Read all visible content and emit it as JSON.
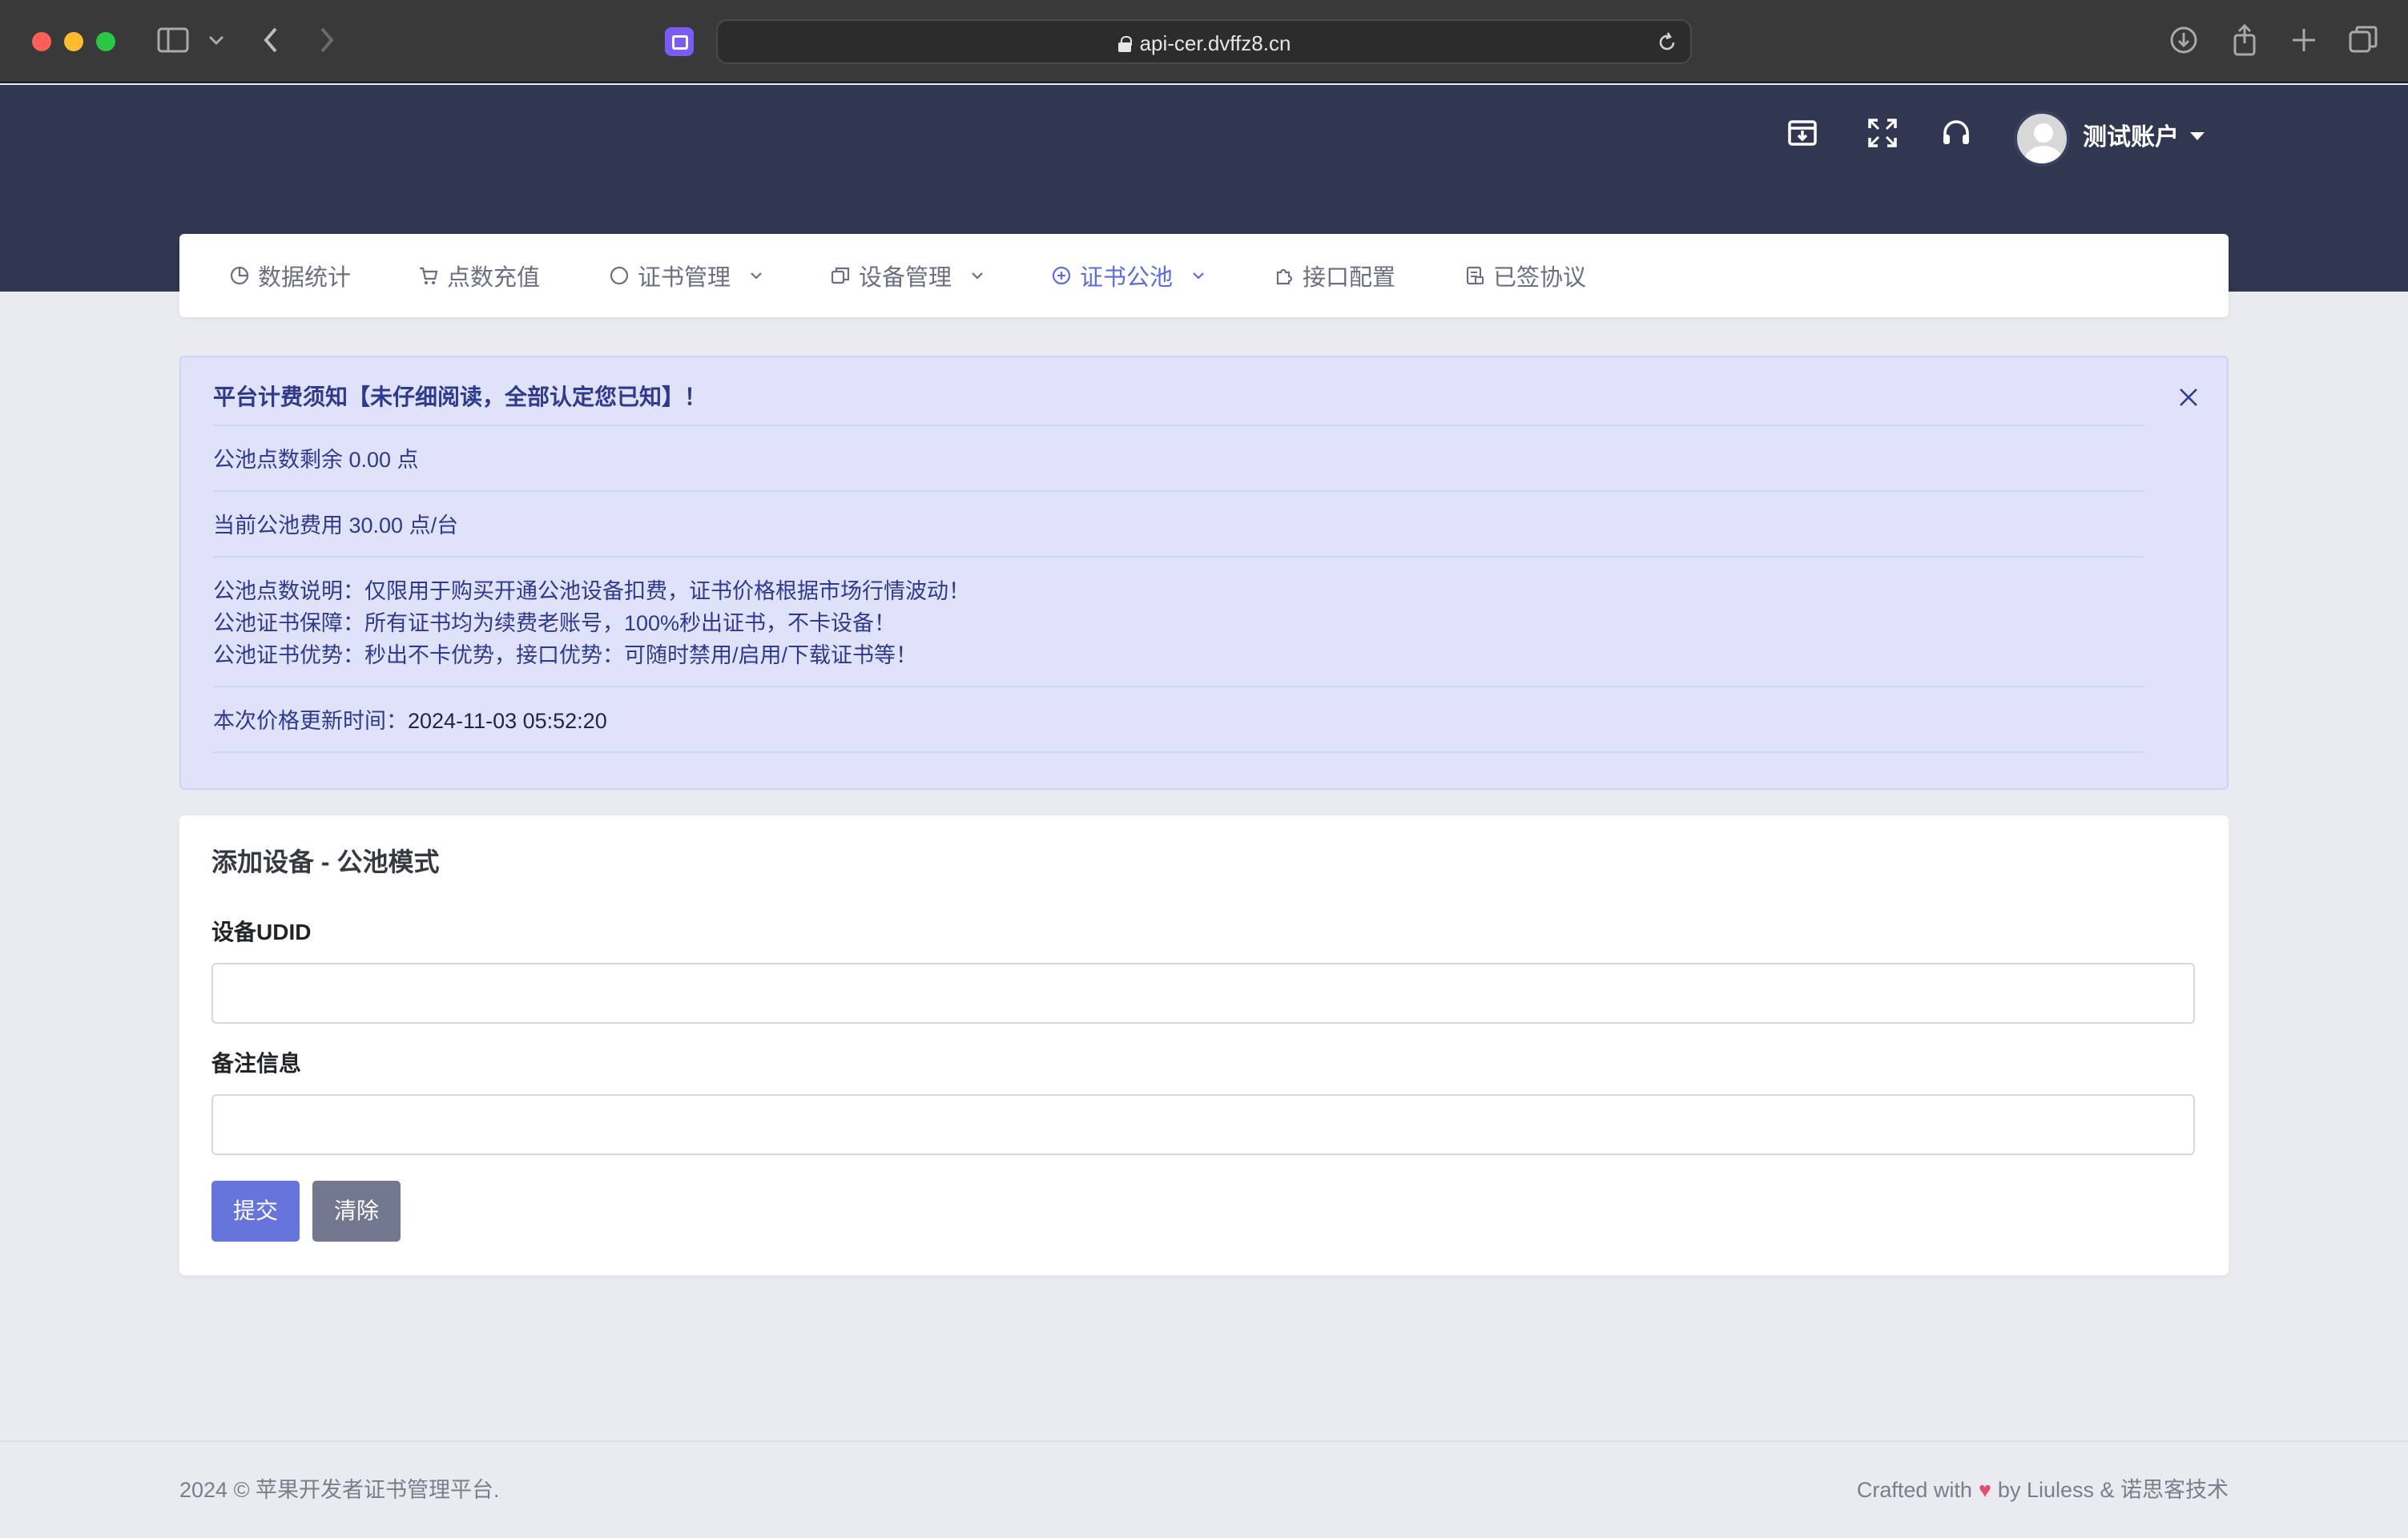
{
  "browser": {
    "url": "api-cer.dvffz8.cn"
  },
  "header": {
    "user_name": "测试账户"
  },
  "nav": {
    "items": [
      {
        "label": "数据统计"
      },
      {
        "label": "点数充值"
      },
      {
        "label": "证书管理"
      },
      {
        "label": "设备管理"
      },
      {
        "label": "证书公池"
      },
      {
        "label": "接口配置"
      },
      {
        "label": "已签协议"
      }
    ],
    "active_item": "证书公池",
    "accent_color": "#5c6be0"
  },
  "notice": {
    "title": "平台计费须知【未仔细阅读，全部认定您已知】！",
    "balance": "公池点数剩余 0.00 点",
    "fee": "当前公池费用 30.00 点/台",
    "desc_1": "公池点数说明：仅限用于购买开通公池设备扣费，证书价格根据市场行情波动！",
    "desc_2": "公池证书保障：所有证书均为续费老账号，100%秒出证书，不卡设备！",
    "desc_3": "公池证书优势：秒出不卡优势，接口优势：可随时禁用/启用/下载证书等！",
    "updated_label": "本次价格更新时间：",
    "updated_value": "2024-11-03 05:52:20"
  },
  "form": {
    "title": "添加设备 - 公池模式",
    "udid_label": "设备UDID",
    "udid_value": "",
    "remark_label": "备注信息",
    "remark_value": "",
    "submit_label": "提交",
    "clear_label": "清除",
    "primary_color": "#6674dc"
  },
  "footer": {
    "copyright": "2024 © 苹果开发者证书管理平台.",
    "crafted_prefix": "Crafted with",
    "heart": "♥",
    "crafted_suffix": "by Liuless & 诺思客技术"
  }
}
